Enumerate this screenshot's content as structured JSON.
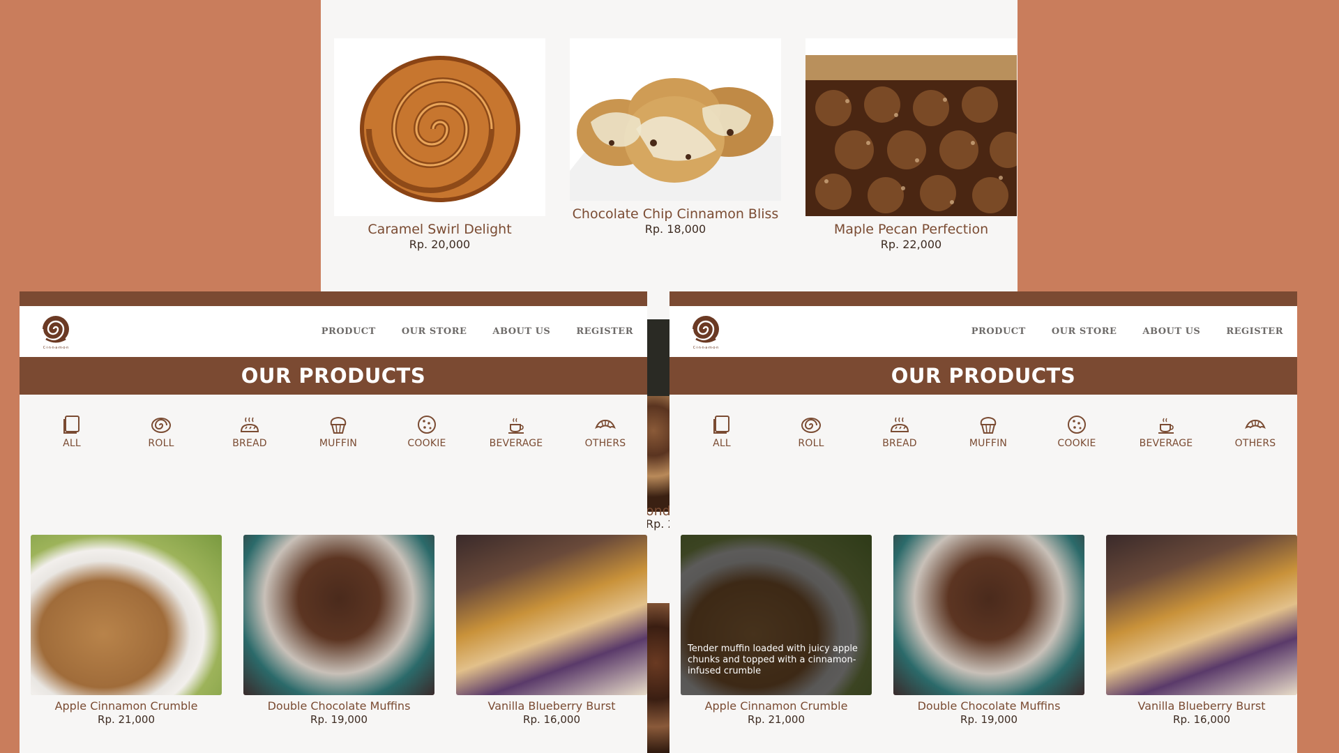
{
  "top_panel": {
    "products": [
      {
        "name": "Caramel Swirl Delight",
        "price": "Rp. 20,000"
      },
      {
        "name": "Chocolate Chip Cinnamon Bliss",
        "price": "Rp. 18,000"
      },
      {
        "name": "Maple Pecan Perfection",
        "price": "Rp. 22,000"
      }
    ]
  },
  "middle_strip": {
    "name_fragment": "ond",
    "price_fragment": "Rp. 2"
  },
  "nav": {
    "links": [
      "PRODUCT",
      "OUR STORE",
      "ABOUT US",
      "REGISTER"
    ]
  },
  "banner": {
    "title": "OUR PRODUCTS"
  },
  "categories": [
    {
      "label": "ALL",
      "icon": "book-icon"
    },
    {
      "label": "ROLL",
      "icon": "roll-icon"
    },
    {
      "label": "BREAD",
      "icon": "bread-icon"
    },
    {
      "label": "MUFFIN",
      "icon": "muffin-icon"
    },
    {
      "label": "COOKIE",
      "icon": "cookie-icon"
    },
    {
      "label": "BEVERAGE",
      "icon": "cup-icon"
    },
    {
      "label": "OTHERS",
      "icon": "croissant-icon"
    }
  ],
  "products": [
    {
      "name": "Apple Cinnamon Crumble",
      "price": "Rp. 21,000"
    },
    {
      "name": "Double Chocolate Muffins",
      "price": "Rp. 19,000"
    },
    {
      "name": "Vanilla Blueberry Burst",
      "price": "Rp. 16,000"
    }
  ],
  "hover_description": "Tender muffin loaded with juicy apple chunks and topped with a cinnamon-infused crumble",
  "colors": {
    "background": "#c97d5c",
    "brand_brown": "#7b4a32",
    "page": "#f7f6f5",
    "text_brown": "#7a4b32"
  }
}
